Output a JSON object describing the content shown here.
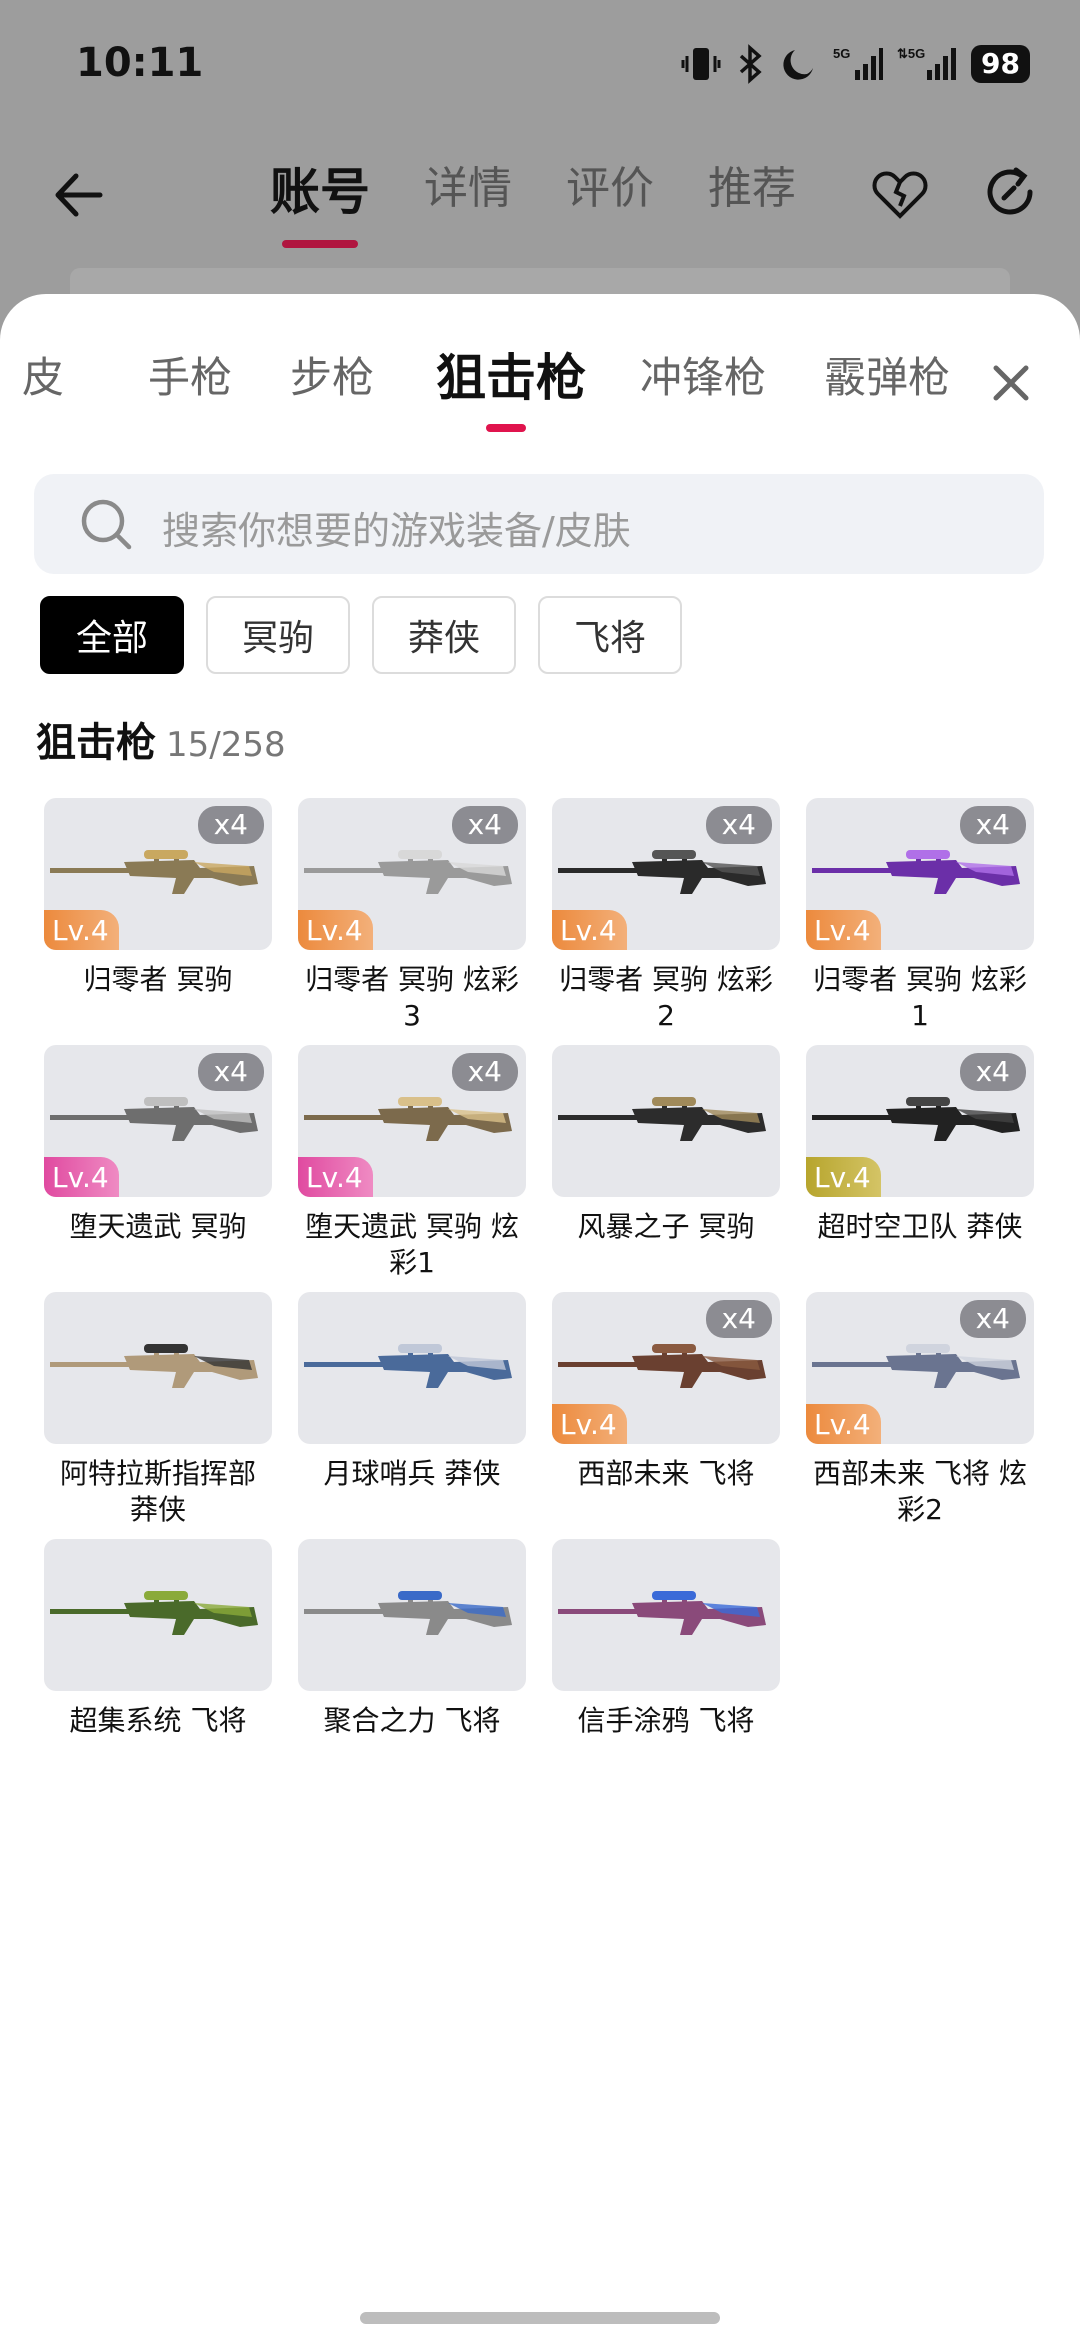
{
  "status": {
    "time": "10:11",
    "battery": "98"
  },
  "top_tabs": [
    "账号",
    "详情",
    "评价",
    "推荐"
  ],
  "category_tabs": [
    "皮",
    "手枪",
    "步枪",
    "狙击枪",
    "冲锋枪",
    "霰弹枪"
  ],
  "search": {
    "placeholder": "搜索你想要的游戏装备/皮肤"
  },
  "filters": [
    "全部",
    "冥驹",
    "莽侠",
    "飞将"
  ],
  "section": {
    "title": "狙击枪",
    "count": "15/258"
  },
  "items": [
    {
      "name": "归零者 冥驹",
      "qty": "x4",
      "level": "Lv.4",
      "level_color": "orange",
      "gun_color": "#8a7a55",
      "accent": "#c9a860"
    },
    {
      "name": "归零者 冥驹 炫彩3",
      "qty": "x4",
      "level": "Lv.4",
      "level_color": "orange",
      "gun_color": "#9a9a9a",
      "accent": "#d8d8d8"
    },
    {
      "name": "归零者 冥驹 炫彩2",
      "qty": "x4",
      "level": "Lv.4",
      "level_color": "orange",
      "gun_color": "#2a2a2a",
      "accent": "#555555"
    },
    {
      "name": "归零者 冥驹 炫彩1",
      "qty": "x4",
      "level": "Lv.4",
      "level_color": "orange",
      "gun_color": "#6b2fa8",
      "accent": "#b070e8"
    },
    {
      "name": "堕天遗武 冥驹",
      "qty": "x4",
      "level": "Lv.4",
      "level_color": "pink",
      "gun_color": "#6e6e6e",
      "accent": "#bfbfbf"
    },
    {
      "name": "堕天遗武 冥驹 炫彩1",
      "qty": "x4",
      "level": "Lv.4",
      "level_color": "pink",
      "gun_color": "#7c6a4c",
      "accent": "#d9c08a"
    },
    {
      "name": "风暴之子 冥驹",
      "qty": "",
      "level": "",
      "level_color": "",
      "gun_color": "#2c2c2c",
      "accent": "#a08a5a"
    },
    {
      "name": "超时空卫队 莽侠",
      "qty": "x4",
      "level": "Lv.4",
      "level_color": "gold",
      "gun_color": "#222222",
      "accent": "#444444"
    },
    {
      "name": "阿特拉斯指挥部 莽侠",
      "qty": "",
      "level": "",
      "level_color": "",
      "gun_color": "#b09a7a",
      "accent": "#333333"
    },
    {
      "name": "月球哨兵 莽侠",
      "qty": "",
      "level": "",
      "level_color": "",
      "gun_color": "#4a6a9a",
      "accent": "#c0c8d8"
    },
    {
      "name": "西部未来 飞将",
      "qty": "x4",
      "level": "Lv.4",
      "level_color": "orange",
      "gun_color": "#6a4030",
      "accent": "#8a5a40"
    },
    {
      "name": "西部未来 飞将 炫彩2",
      "qty": "x4",
      "level": "Lv.4",
      "level_color": "orange",
      "gun_color": "#6a7490",
      "accent": "#d0d4de"
    },
    {
      "name": "超集系统 飞将",
      "qty": "",
      "level": "",
      "level_color": "",
      "gun_color": "#4a6a2a",
      "accent": "#8aaa3a"
    },
    {
      "name": "聚合之力 飞将",
      "qty": "",
      "level": "",
      "level_color": "",
      "gun_color": "#8a8a8a",
      "accent": "#3a6ac8"
    },
    {
      "name": "信手涂鸦 飞将",
      "qty": "",
      "level": "",
      "level_color": "",
      "gun_color": "#8a4a7a",
      "accent": "#3a6ad8"
    }
  ]
}
